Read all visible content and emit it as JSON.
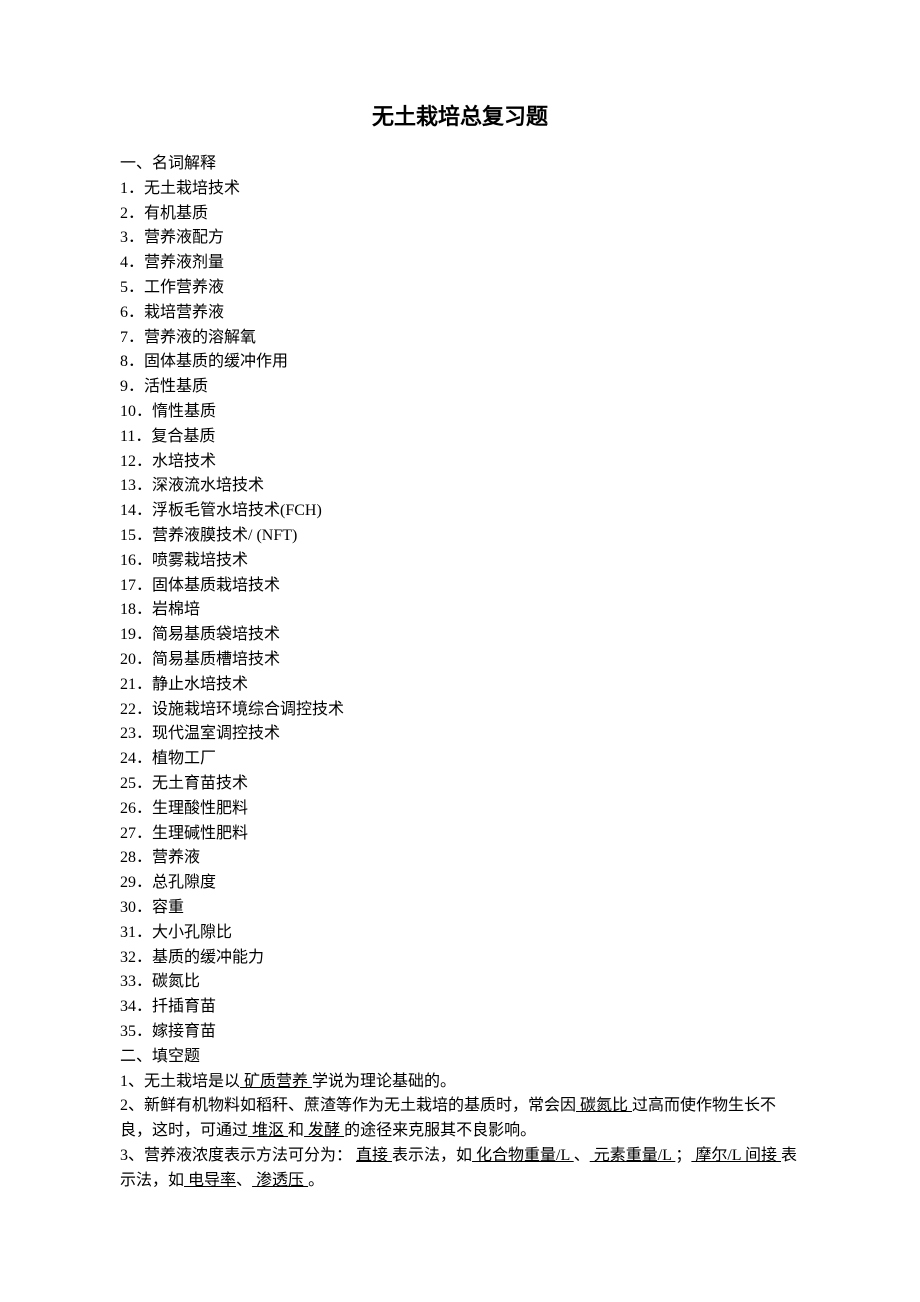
{
  "title": "无土栽培总复习题",
  "section1": {
    "heading": "一、名词解释",
    "items": [
      "无土栽培技术",
      "有机基质",
      "营养液配方",
      "营养液剂量",
      "工作营养液",
      "栽培营养液",
      "营养液的溶解氧",
      "固体基质的缓冲作用",
      "活性基质",
      "惰性基质",
      "复合基质",
      "水培技术",
      "深液流水培技术",
      "浮板毛管水培技术(FCH)",
      "营养液膜技术/ (NFT)",
      "喷雾栽培技术",
      "固体基质栽培技术",
      "岩棉培",
      "简易基质袋培技术",
      "简易基质槽培技术",
      "静止水培技术",
      "设施栽培环境综合调控技术",
      "现代温室调控技术",
      "植物工厂",
      "无土育苗技术",
      "生理酸性肥料",
      "生理碱性肥料",
      "营养液",
      "总孔隙度",
      "容重",
      "大小孔隙比",
      "基质的缓冲能力",
      "碳氮比",
      "扦插育苗",
      "嫁接育苗"
    ]
  },
  "section2": {
    "heading": "二、填空题",
    "q1": {
      "pre": "1、无土栽培是以",
      "blank": " 矿质营养 ",
      "post": "学说为理论基础的。"
    },
    "q2": {
      "pre": "2、新鲜有机物料如稻秆、蔗渣等作为无土栽培的基质时，常会因",
      "b1": " 碳氮比  ",
      "mid1": "过高而使作物生长不良，这时，可通过",
      "b2": " 堆沤   ",
      "mid2": "和",
      "b3": " 发酵  ",
      "post": "的途径来克服其不良影响。"
    },
    "q3": {
      "pre": "3、营养液浓度表示方法可分为：         ",
      "b1": "直接    ",
      "mid1": "表示法，如",
      "b2": " 化合物重量/L       ",
      "mid2": "、",
      "b3": "   元素重量/L         ",
      "mid3": "；",
      "b4": "   摩尔/L      ",
      "b5": "间接  ",
      "mid4": "表示法，如",
      "b6": "   电导率",
      "mid5": "、",
      "b7": "     渗透压  ",
      "post": "。"
    }
  }
}
